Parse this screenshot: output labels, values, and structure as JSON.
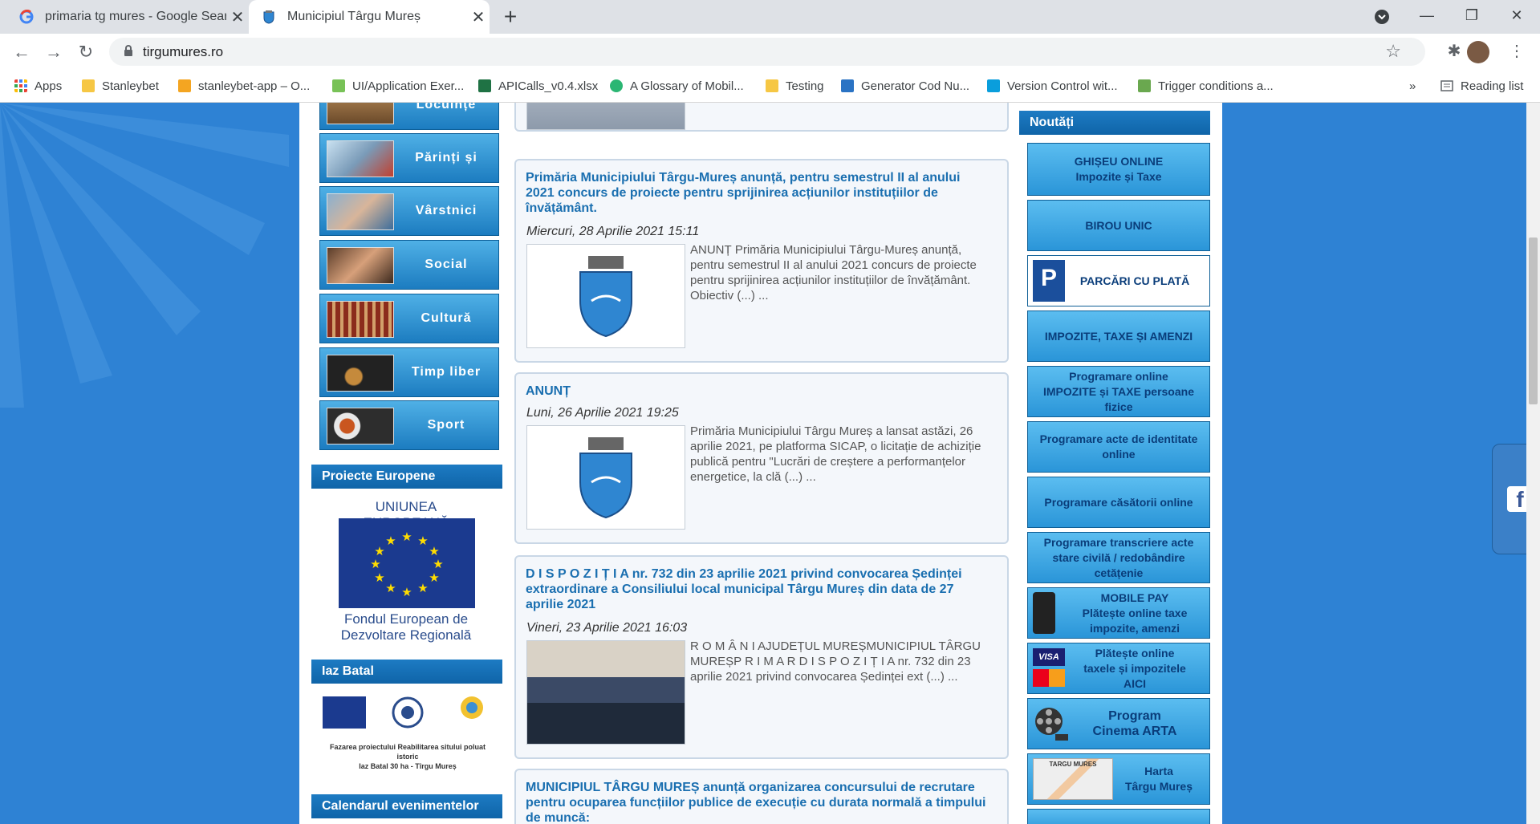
{
  "browser": {
    "tabs": [
      {
        "title": "primaria tg mures - Google Search",
        "active": false
      },
      {
        "title": "Municipiul Târgu Mureș",
        "active": true
      }
    ],
    "url": "tirgumures.ro",
    "bookmarks": [
      {
        "label": "Apps",
        "color": "#ea4335"
      },
      {
        "label": "Stanleybet",
        "color": "#f6c744"
      },
      {
        "label": "stanleybet-app – O...",
        "color": "#f4a521"
      },
      {
        "label": "UI/Application Exer...",
        "color": "#78c257"
      },
      {
        "label": "APICalls_v0.4.xlsx",
        "color": "#1f7244"
      },
      {
        "label": "A Glossary of Mobil...",
        "color": "#2bb673"
      },
      {
        "label": "Testing",
        "color": "#f6c744"
      },
      {
        "label": "Generator Cod Nu...",
        "color": "#2a73c4"
      },
      {
        "label": "Version Control wit...",
        "color": "#0a9edc"
      },
      {
        "label": "Trigger conditions a...",
        "color": "#6aa84f"
      }
    ],
    "reading_list": "Reading list",
    "overflow": "»"
  },
  "left_menu": {
    "categories": [
      "Locuințe",
      "Părinți și copii",
      "Vârstnici",
      "Social",
      "Cultură",
      "Timp liber",
      "Sport"
    ],
    "proiecte_europene": "Proiecte Europene",
    "eu_banner": {
      "top": "UNIUNEA EUROPEANĂ",
      "bottom1": "Fondul European de",
      "bottom2": "Dezvoltare Regională"
    },
    "iaz_batal": "Iaz Batal",
    "iaz_caption1": "Fazarea proiectului Reabilitarea sitului poluat istoric",
    "iaz_caption2": "Iaz Batal 30 ha - Tîrgu Mureș",
    "calendar": "Calendarul evenimentelor"
  },
  "news": [
    {
      "title": "Primăria Municipiului Târgu-Mureș anunță, pentru semestrul II al anului 2021 concurs de proiecte pentru sprijinirea acțiunilor instituțiilor de învățământ.",
      "date": "Miercuri, 28 Aprilie 2021 15:11",
      "excerpt": "  ANUNȚ Primăria Municipiului Târgu-Mureș anunță, pentru  semestrul II al anului 2021 concurs de proiecte pentru sprijinirea  acțiunilor instituțiilor de învățământ. Obiectiv (...) ..."
    },
    {
      "title": "ANUNȚ",
      "date": "Luni, 26 Aprilie 2021 19:25",
      "excerpt": "  Primăria Municipiului Târgu Mureș a lansat astăzi, 26 aprilie 2021, pe platforma SICAP, o licitație de achiziție publică pentru \"Lucrări de creștere a performanțelor energetice, la clă (...) ..."
    },
    {
      "title": "D I S P O Z I Ț I A nr. 732 din 23 aprilie 2021 privind convocarea Ședinței extraordinare a Consiliului local municipal Târgu Mureș din data de 27 aprilie 2021",
      "date": "Vineri, 23 Aprilie 2021 16:03",
      "excerpt": "  R O M Â N I AJUDEȚUL MUREȘMUNICIPIUL TÂRGU  MUREȘP R I M A R D I S P O Z I Ț I A  nr. 732 din  23  aprilie  2021 privind convocarea Ședinței ext (...) ..."
    },
    {
      "title": "MUNICIPIUL TÂRGU MUREȘ anunță organizarea concursului de recrutare pentru ocuparea funcțiilor publice de execuție cu durata normală a timpului de muncă:",
      "date": "",
      "excerpt": ""
    }
  ],
  "right_menu": {
    "header": "Noutăți",
    "services": [
      {
        "lines": [
          "GHIȘEU ONLINE",
          "Impozite și Taxe"
        ]
      },
      {
        "lines": [
          "BIROU UNIC"
        ]
      },
      {
        "lines": [
          "PARCĂRI CU PLATĂ"
        ],
        "icon_letter": "P"
      },
      {
        "lines": [
          "IMPOZITE, TAXE ȘI AMENZI"
        ]
      },
      {
        "lines": [
          "Programare online",
          "IMPOZITE și TAXE persoane fizice"
        ]
      },
      {
        "lines": [
          "Programare acte de identitate",
          "online"
        ]
      },
      {
        "lines": [
          "Programare căsătorii online"
        ]
      },
      {
        "lines": [
          "Programare transcriere acte",
          "stare civilă / redobândire cetățenie"
        ]
      },
      {
        "lines": [
          "MOBILE PAY",
          "Plătește online taxe",
          "impozite, amenzi"
        ]
      },
      {
        "lines": [
          "Plătește online",
          "taxele și impozitele",
          "AICI"
        ],
        "card_label": "VISA"
      },
      {
        "lines": [
          "Program",
          "Cinema ARTA"
        ]
      },
      {
        "lines": [
          "Harta",
          "Târgu Mureș"
        ],
        "map_label": "TARGU MURES"
      }
    ]
  },
  "social": {
    "facebook": "f"
  }
}
